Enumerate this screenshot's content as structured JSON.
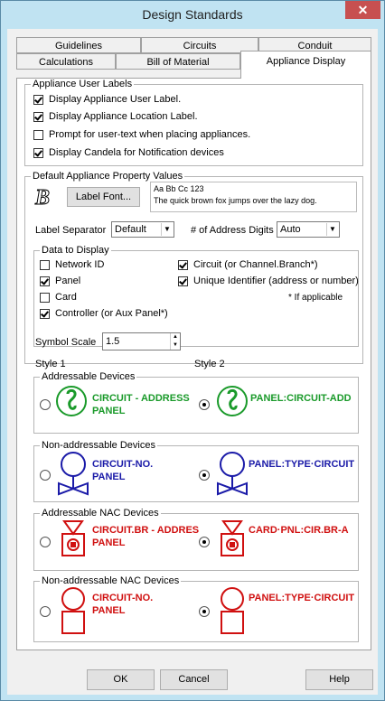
{
  "window": {
    "title": "Design Standards",
    "close": "✕"
  },
  "tabs": {
    "row1": [
      "Guidelines",
      "Circuits",
      "Conduit"
    ],
    "row2": [
      "Calculations",
      "Bill of Material",
      "Appliance Display"
    ]
  },
  "user_labels": {
    "title": "Appliance User Labels",
    "items": [
      {
        "label": "Display Appliance User Label.",
        "checked": true
      },
      {
        "label": "Display Appliance Location Label.",
        "checked": true
      },
      {
        "label": "Prompt for user-text when placing appliances.",
        "checked": false
      },
      {
        "label": "Display Candela for Notification devices",
        "checked": true
      }
    ]
  },
  "defaults": {
    "title": "Default Appliance Property Values",
    "label_font_button": "Label Font...",
    "font_icon": "font-B-icon",
    "preview_line1": "Aa Bb Cc 123",
    "preview_line2": "The quick brown fox jumps over the lazy dog.",
    "separator_label": "Label Separator",
    "separator_value": "Default",
    "digits_label": "# of Address Digits",
    "digits_value": "Auto"
  },
  "data_display": {
    "title": "Data to Display",
    "left": [
      {
        "label": "Network ID",
        "checked": false
      },
      {
        "label": "Panel",
        "checked": true
      },
      {
        "label": "Card",
        "checked": false
      },
      {
        "label": "Controller (or Aux Panel*)",
        "checked": true
      }
    ],
    "right": [
      {
        "label": "Circuit (or Channel.Branch*)",
        "checked": true
      },
      {
        "label": "Unique Identifier (address or number)",
        "checked": true
      }
    ],
    "note": "* If applicable"
  },
  "symbol_scale": {
    "label": "Symbol Scale",
    "value": "1.5"
  },
  "styles": {
    "style1": "Style 1",
    "style2": "Style 2",
    "groups": [
      {
        "title": "Addressable Devices",
        "s1_line1": "CIRCUIT - ADDRESS",
        "s1_line2": "PANEL",
        "s2_line1": "PANEL:CIRCUIT-ADD",
        "selected": 2
      },
      {
        "title": "Non-addressable Devices",
        "s1_line1": "CIRCUIT-NO.",
        "s1_line2": "PANEL",
        "s2_line1": "PANEL:TYPE·CIRCUIT",
        "selected": 2
      },
      {
        "title": "Addressable NAC Devices",
        "s1_line1": "CIRCUIT.BR - ADDRES",
        "s1_line2": "PANEL",
        "s2_line1": "CARD·PNL:CIR.BR-A",
        "selected": 2
      },
      {
        "title": "Non-addressable NAC Devices",
        "s1_line1": "CIRCUIT-NO.",
        "s1_line2": "PANEL",
        "s2_line1": "PANEL:TYPE·CIRCUIT",
        "selected": 2
      }
    ]
  },
  "buttons": {
    "ok": "OK",
    "cancel": "Cancel",
    "help": "Help"
  },
  "colors": {
    "green": "#1a9a2a",
    "blue": "#1a1aa8",
    "red": "#d01010"
  }
}
